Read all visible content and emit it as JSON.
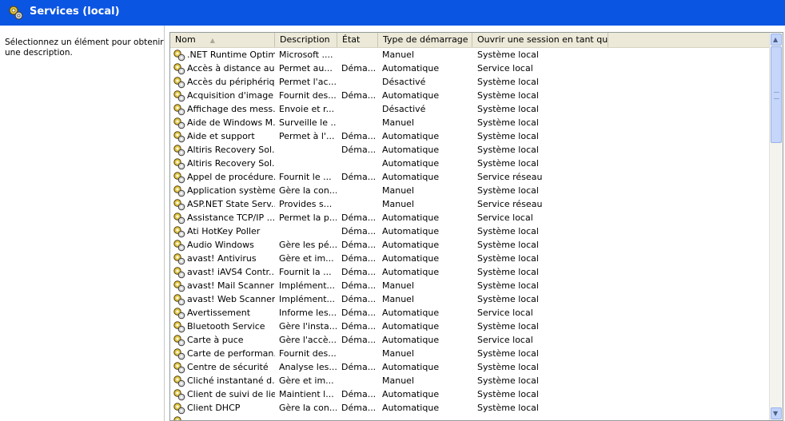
{
  "window": {
    "title": "Services (local)",
    "title_icon": "gears-icon",
    "accent": "#0b55e3"
  },
  "left_pane": {
    "description": "Sélectionnez un élément pour obtenir une description."
  },
  "columns": {
    "name": "Nom",
    "description": "Description",
    "state": "État",
    "startup": "Type de démarrage",
    "logon": "Ouvrir une session en tant que",
    "sort_column": "name"
  },
  "rows": [
    {
      "name": ".NET Runtime Optim...",
      "desc": "Microsoft ....",
      "state": "",
      "startup": "Manuel",
      "logon": "Système local"
    },
    {
      "name": "Accès à distance au...",
      "desc": "Permet au...",
      "state": "Déma...",
      "startup": "Automatique",
      "logon": "Service local"
    },
    {
      "name": "Accès du périphériq...",
      "desc": "Permet l'ac...",
      "state": "",
      "startup": "Désactivé",
      "logon": "Système local"
    },
    {
      "name": "Acquisition d'image ...",
      "desc": "Fournit des...",
      "state": "Déma...",
      "startup": "Automatique",
      "logon": "Système local"
    },
    {
      "name": "Affichage des mess...",
      "desc": "Envoie et r...",
      "state": "",
      "startup": "Désactivé",
      "logon": "Système local"
    },
    {
      "name": "Aide de Windows M...",
      "desc": "Surveille le ...",
      "state": "",
      "startup": "Manuel",
      "logon": "Système local"
    },
    {
      "name": "Aide et support",
      "desc": "Permet à l'...",
      "state": "Déma...",
      "startup": "Automatique",
      "logon": "Système local"
    },
    {
      "name": "Altiris Recovery Sol...",
      "desc": "",
      "state": "Déma...",
      "startup": "Automatique",
      "logon": "Système local"
    },
    {
      "name": "Altiris Recovery Sol...",
      "desc": "",
      "state": "",
      "startup": "Automatique",
      "logon": "Système local"
    },
    {
      "name": "Appel de procédure...",
      "desc": "Fournit le ...",
      "state": "Déma...",
      "startup": "Automatique",
      "logon": "Service réseau"
    },
    {
      "name": "Application système...",
      "desc": "Gère la con...",
      "state": "",
      "startup": "Manuel",
      "logon": "Système local"
    },
    {
      "name": "ASP.NET State Serv...",
      "desc": "Provides s...",
      "state": "",
      "startup": "Manuel",
      "logon": "Service réseau"
    },
    {
      "name": "Assistance TCP/IP ...",
      "desc": "Permet la p...",
      "state": "Déma...",
      "startup": "Automatique",
      "logon": "Service local"
    },
    {
      "name": "Ati HotKey Poller",
      "desc": "",
      "state": "Déma...",
      "startup": "Automatique",
      "logon": "Système local"
    },
    {
      "name": "Audio Windows",
      "desc": "Gère les pé...",
      "state": "Déma...",
      "startup": "Automatique",
      "logon": "Système local"
    },
    {
      "name": "avast! Antivirus",
      "desc": "Gère et im...",
      "state": "Déma...",
      "startup": "Automatique",
      "logon": "Système local"
    },
    {
      "name": "avast! iAVS4 Contr...",
      "desc": "Fournit la ...",
      "state": "Déma...",
      "startup": "Automatique",
      "logon": "Système local"
    },
    {
      "name": "avast! Mail Scanner",
      "desc": "Implément...",
      "state": "Déma...",
      "startup": "Manuel",
      "logon": "Système local"
    },
    {
      "name": "avast! Web Scanner",
      "desc": "Implément...",
      "state": "Déma...",
      "startup": "Manuel",
      "logon": "Système local"
    },
    {
      "name": "Avertissement",
      "desc": "Informe les...",
      "state": "Déma...",
      "startup": "Automatique",
      "logon": "Service local"
    },
    {
      "name": "Bluetooth Service",
      "desc": "Gère l'insta...",
      "state": "Déma...",
      "startup": "Automatique",
      "logon": "Système local"
    },
    {
      "name": "Carte à puce",
      "desc": "Gère l'accè...",
      "state": "Déma...",
      "startup": "Automatique",
      "logon": "Service local"
    },
    {
      "name": "Carte de performan...",
      "desc": "Fournit des...",
      "state": "",
      "startup": "Manuel",
      "logon": "Système local"
    },
    {
      "name": "Centre de sécurité",
      "desc": "Analyse les...",
      "state": "Déma...",
      "startup": "Automatique",
      "logon": "Système local"
    },
    {
      "name": "Cliché instantané d...",
      "desc": "Gère et im...",
      "state": "",
      "startup": "Manuel",
      "logon": "Système local"
    },
    {
      "name": "Client de suivi de lie...",
      "desc": "Maintient l...",
      "state": "Déma...",
      "startup": "Automatique",
      "logon": "Système local"
    },
    {
      "name": "Client DHCP",
      "desc": "Gère la con...",
      "state": "Déma...",
      "startup": "Automatique",
      "logon": "Système local"
    },
    {
      "name": "",
      "desc": "",
      "state": "",
      "startup": "",
      "logon": ""
    }
  ],
  "row_icon": "gears-icon",
  "scrollbar": {
    "up_icon": "scroll-up-arrow-icon",
    "down_icon": "scroll-down-arrow-icon"
  }
}
